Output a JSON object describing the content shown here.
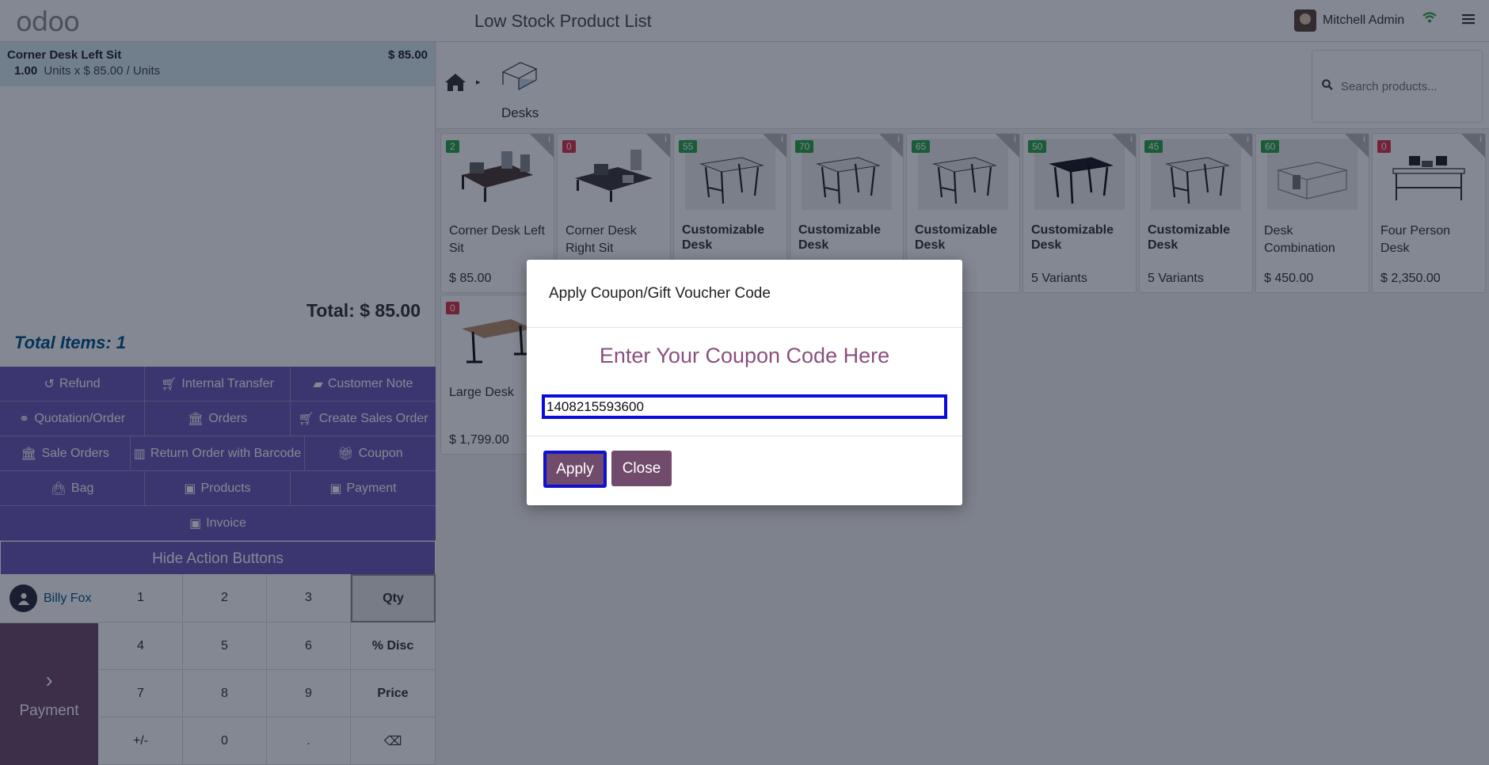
{
  "header": {
    "logo": "odoo",
    "title": "Low Stock Product List",
    "user_name": "Mitchell Admin"
  },
  "order": {
    "line": {
      "name": "Corner Desk Left Sit",
      "price": "$ 85.00",
      "qty": "1.00",
      "detail": "Units x $ 85.00 / Units"
    },
    "total": "Total: $ 85.00",
    "total_items": "Total Items: 1"
  },
  "actions": {
    "refund": "Refund",
    "internal_transfer": "Internal Transfer",
    "customer_note": "Customer Note",
    "quotation_order": "Quotation/Order",
    "orders": "Orders",
    "create_sales_order": "Create Sales Order",
    "sale_orders": "Sale Orders",
    "return_order_barcode": "Return Order with Barcode",
    "coupon": "Coupon",
    "bag": "Bag",
    "products": "Products",
    "payment": "Payment",
    "invoice": "Invoice",
    "hide": "Hide Action Buttons"
  },
  "numpad": {
    "customer": "Billy Fox",
    "payment": "Payment",
    "keys": [
      "1",
      "2",
      "3",
      "Qty",
      "4",
      "5",
      "6",
      "% Disc",
      "7",
      "8",
      "9",
      "Price",
      "+/-",
      "0",
      ".",
      "⌫"
    ]
  },
  "breadcrumb": {
    "category": "Desks"
  },
  "search": {
    "placeholder": "Search products..."
  },
  "products": [
    {
      "name": "Corner Desk Left Sit",
      "price": "$ 85.00",
      "qty": "2",
      "stock": "green"
    },
    {
      "name": "Corner Desk Right Sit",
      "price": "",
      "qty": "0",
      "stock": "red"
    },
    {
      "name": "Customizable Desk",
      "price": "",
      "qty": "55",
      "stock": "green"
    },
    {
      "name": "Customizable Desk",
      "price": "",
      "qty": "70",
      "stock": "green"
    },
    {
      "name": "Customizable Desk",
      "price": "s",
      "qty": "65",
      "stock": "green"
    },
    {
      "name": "Customizable Desk",
      "price": "5 Variants",
      "qty": "50",
      "stock": "green"
    },
    {
      "name": "Customizable Desk",
      "price": "5 Variants",
      "qty": "45",
      "stock": "green"
    },
    {
      "name": "Desk Combination",
      "price": "$ 450.00",
      "qty": "60",
      "stock": "green"
    },
    {
      "name": "Four Person Desk",
      "price": "$ 2,350.00",
      "qty": "0",
      "stock": "red"
    },
    {
      "name": "Large Desk",
      "price": "$ 1,799.00",
      "qty": "0",
      "stock": "red"
    }
  ],
  "dialog": {
    "title": "Apply Coupon/Gift Voucher Code",
    "subtitle": "Enter Your Coupon Code Here",
    "code_value": "1408215593600",
    "apply": "Apply",
    "close": "Close"
  },
  "colors": {
    "action_purple": "#6d5bb7",
    "odoo_purple": "#714b6b",
    "focus_blue": "#0b0bdc"
  }
}
